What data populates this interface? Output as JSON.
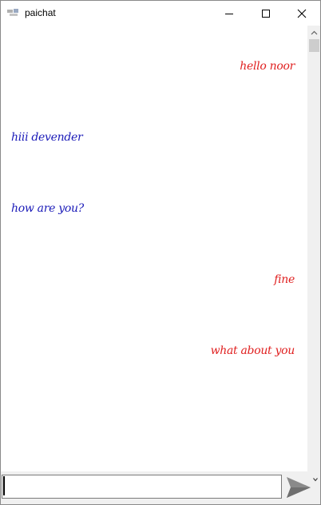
{
  "window": {
    "title": "paichat",
    "icons": {
      "app": "paichat-app-icon",
      "minimize": "minimize-icon",
      "maximize": "maximize-icon",
      "close": "close-icon",
      "scroll_up": "chevron-up-icon",
      "send": "send-icon",
      "dropdown": "chevron-down-icon"
    }
  },
  "chat": {
    "messages": [
      {
        "text": "hello noor",
        "direction": "outgoing",
        "color": "#e02020"
      },
      {
        "text": "hiii devender",
        "direction": "incoming",
        "color": "#1a1ab8"
      },
      {
        "text": "how are you?",
        "direction": "incoming",
        "color": "#1a1ab8"
      },
      {
        "text": "fine",
        "direction": "outgoing",
        "color": "#e02020"
      },
      {
        "text": "what about you",
        "direction": "outgoing",
        "color": "#e02020"
      }
    ]
  },
  "composer": {
    "value": "",
    "placeholder": ""
  },
  "colors": {
    "outgoing_text": "#e02020",
    "incoming_text": "#1a1ab8",
    "send_icon": "#8a8a8a",
    "bottom_bar": "#f0f0f0",
    "scrollbar_track": "#f0f0f0",
    "scrollbar_thumb": "#cdcdcd"
  }
}
